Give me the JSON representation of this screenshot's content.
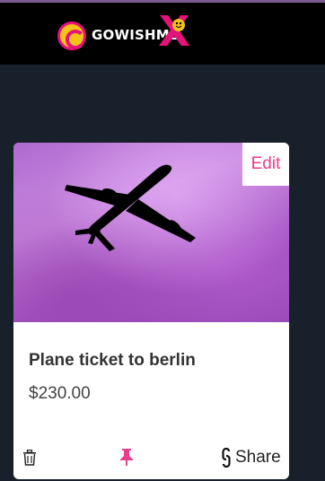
{
  "header": {
    "logo_text": "GOWISHME"
  },
  "card": {
    "edit_label": "Edit",
    "title": "Plane ticket to berlin",
    "price": "$230.00",
    "share_label": "Share"
  },
  "icons": {
    "trash": "trash-icon",
    "pin": "pin-icon",
    "share": "link-icon"
  },
  "colors": {
    "accent": "#e83e8c",
    "background": "#18212b",
    "header": "#000000",
    "logo_yellow": "#f2c318"
  }
}
